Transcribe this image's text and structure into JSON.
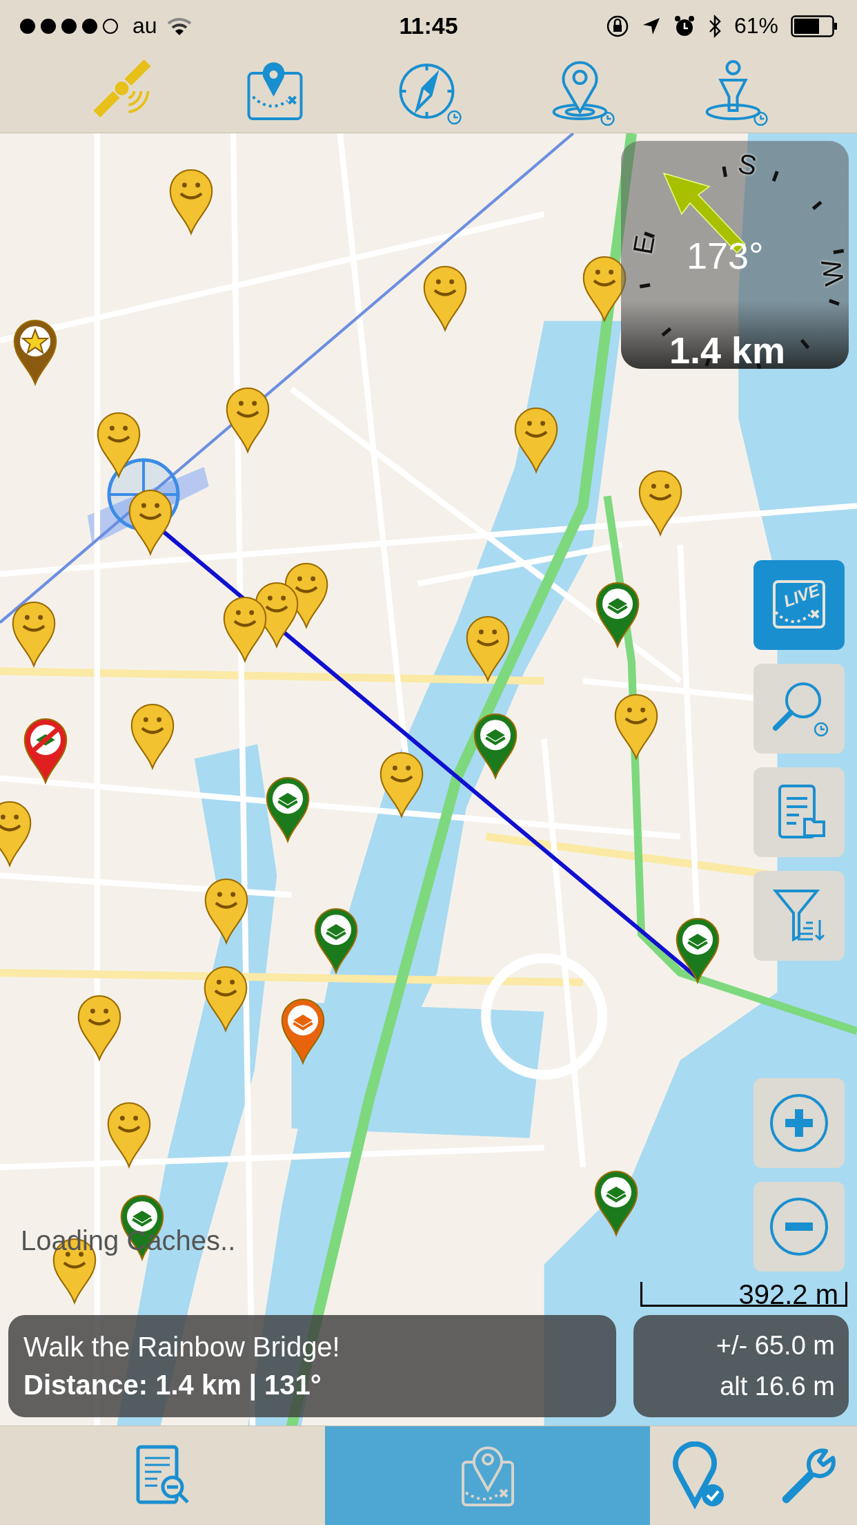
{
  "status_bar": {
    "carrier": "au",
    "time": "11:45",
    "battery_percent": "61%"
  },
  "toolbar": [
    {
      "kind": "satellite"
    },
    {
      "kind": "map"
    },
    {
      "kind": "compass"
    },
    {
      "kind": "pin"
    },
    {
      "kind": "person"
    }
  ],
  "pins": [
    {
      "kind": "smiley",
      "color": "#f2c230"
    },
    {
      "kind": "smiley",
      "color": "#f2c230"
    },
    {
      "kind": "smiley",
      "color": "#f2c230"
    },
    {
      "kind": "smiley",
      "color": "#f2c230"
    },
    {
      "kind": "smiley",
      "color": "#f2c230"
    },
    {
      "kind": "smiley",
      "color": "#f2c230"
    },
    {
      "kind": "smiley",
      "color": "#f2c230"
    },
    {
      "kind": "smiley",
      "color": "#f2c230"
    },
    {
      "kind": "smiley",
      "color": "#f2c230"
    },
    {
      "kind": "smiley",
      "color": "#f2c230"
    },
    {
      "kind": "smiley",
      "color": "#f2c230"
    },
    {
      "kind": "smiley",
      "color": "#f2c230"
    },
    {
      "kind": "smiley",
      "color": "#f2c230"
    },
    {
      "kind": "smiley",
      "color": "#f2c230"
    },
    {
      "kind": "smiley",
      "color": "#f2c230"
    },
    {
      "kind": "smiley",
      "color": "#f2c230"
    },
    {
      "kind": "smiley",
      "color": "#f2c230"
    },
    {
      "kind": "smiley",
      "color": "#f2c230"
    },
    {
      "kind": "smiley",
      "color": "#f2c230"
    },
    {
      "kind": "smiley",
      "color": "#f2c230"
    },
    {
      "kind": "smiley",
      "color": "#f2c230"
    },
    {
      "kind": "smiley",
      "color": "#f2c230"
    },
    {
      "kind": "cache",
      "color": "#1b7a1b"
    },
    {
      "kind": "cache",
      "color": "#1b7a1b"
    },
    {
      "kind": "cache",
      "color": "#1b7a1b"
    },
    {
      "kind": "cache",
      "color": "#1b7a1b"
    },
    {
      "kind": "cache",
      "color": "#1b7a1b"
    },
    {
      "kind": "cache",
      "color": "#1b7a1b"
    },
    {
      "kind": "cache",
      "color": "#1b7a1b"
    },
    {
      "kind": "cache",
      "color": "#e8640c"
    },
    {
      "kind": "disabled",
      "color": "#e02020"
    },
    {
      "kind": "star",
      "color": "#8a5a10"
    }
  ],
  "compass": {
    "heading": "173°",
    "distance": "1.4 km",
    "labels": [
      {
        "kind": "S",
        "text": "S"
      },
      {
        "kind": "E",
        "text": "E"
      },
      {
        "kind": "W",
        "text": "W"
      }
    ]
  },
  "map_tools": [
    {
      "kind": "live",
      "on": true,
      "label": "LIVE"
    },
    {
      "kind": "search",
      "on": false
    },
    {
      "kind": "list",
      "on": false
    },
    {
      "kind": "filter",
      "on": false
    }
  ],
  "zoom_controls": [
    {
      "kind": "zoom-in"
    },
    {
      "kind": "zoom-out"
    }
  ],
  "loading_text": "Loading Caches..",
  "scale": "392.2 m",
  "target": {
    "name": "Walk the Rainbow Bridge!",
    "distance": "Distance: 1.4 km | 131°"
  },
  "gps": {
    "accuracy": "+/- 65.0 m",
    "altitude": "alt 16.6 m"
  },
  "tabs": [
    {
      "kind": "search-list",
      "selected": false
    },
    {
      "kind": "map",
      "selected": true
    },
    {
      "kind": "found",
      "selected": false
    },
    {
      "kind": "settings",
      "selected": false
    }
  ]
}
